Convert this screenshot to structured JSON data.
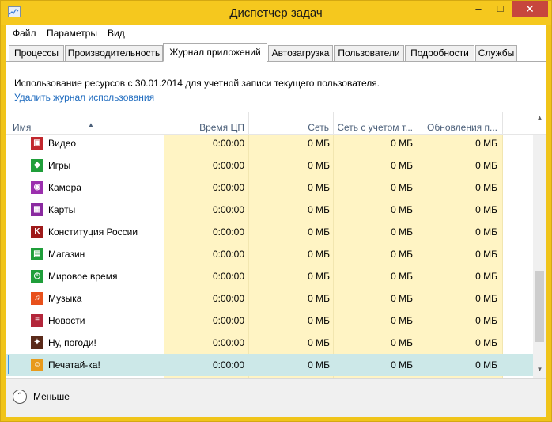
{
  "window": {
    "title": "Диспетчер задач",
    "min_glyph": "–",
    "max_glyph": "□",
    "close_glyph": "✕"
  },
  "menu": [
    {
      "id": "file",
      "label": "Файл"
    },
    {
      "id": "params",
      "label": "Параметры"
    },
    {
      "id": "view",
      "label": "Вид"
    }
  ],
  "tabs": [
    {
      "label": "Процессы"
    },
    {
      "label": "Производительность"
    },
    {
      "label": "Журнал приложений",
      "active": true
    },
    {
      "label": "Автозагрузка"
    },
    {
      "label": "Пользователи"
    },
    {
      "label": "Подробности"
    },
    {
      "label": "Службы"
    }
  ],
  "history": {
    "info_text": "Использование ресурсов с 30.01.2014 для учетной записи текущего пользователя.",
    "delete_link": "Удалить журнал использования"
  },
  "columns": {
    "name": "Имя",
    "cpu": "Время ЦП",
    "net": "Сеть",
    "metered": "Сеть с учетом т...",
    "updates": "Обновления п..."
  },
  "rows": [
    {
      "name": "Видео",
      "icon": "video-icon",
      "color": "#c1272d",
      "glyph": "▣",
      "cpu": "0:00:00",
      "net": "0 МБ",
      "metered": "0 МБ",
      "updates": "0 МБ"
    },
    {
      "name": "Игры",
      "icon": "games-icon",
      "color": "#1f9e3a",
      "glyph": "◆",
      "cpu": "0:00:00",
      "net": "0 МБ",
      "metered": "0 МБ",
      "updates": "0 МБ"
    },
    {
      "name": "Камера",
      "icon": "camera-icon",
      "color": "#9b2fae",
      "glyph": "◉",
      "cpu": "0:00:00",
      "net": "0 МБ",
      "metered": "0 МБ",
      "updates": "0 МБ"
    },
    {
      "name": "Карты",
      "icon": "maps-icon",
      "color": "#8a2aa0",
      "glyph": "▦",
      "cpu": "0:00:00",
      "net": "0 МБ",
      "metered": "0 МБ",
      "updates": "0 МБ"
    },
    {
      "name": "Конституция России",
      "icon": "constitution-icon",
      "color": "#9e1a1a",
      "glyph": "K",
      "cpu": "0:00:00",
      "net": "0 МБ",
      "metered": "0 МБ",
      "updates": "0 МБ"
    },
    {
      "name": "Магазин",
      "icon": "store-icon",
      "color": "#1f9e3a",
      "glyph": "▤",
      "cpu": "0:00:00",
      "net": "0 МБ",
      "metered": "0 МБ",
      "updates": "0 МБ"
    },
    {
      "name": "Мировое время",
      "icon": "clock-icon",
      "color": "#1f9e3a",
      "glyph": "◷",
      "cpu": "0:00:00",
      "net": "0 МБ",
      "metered": "0 МБ",
      "updates": "0 МБ"
    },
    {
      "name": "Музыка",
      "icon": "music-icon",
      "color": "#e8501b",
      "glyph": "♫",
      "cpu": "0:00:00",
      "net": "0 МБ",
      "metered": "0 МБ",
      "updates": "0 МБ"
    },
    {
      "name": "Новости",
      "icon": "news-icon",
      "color": "#b3263a",
      "glyph": "≡",
      "cpu": "0:00:00",
      "net": "0 МБ",
      "metered": "0 МБ",
      "updates": "0 МБ"
    },
    {
      "name": "Ну, погоди!",
      "icon": "game-nu-pogodi-icon",
      "color": "#5a2a1a",
      "glyph": "✦",
      "cpu": "0:00:00",
      "net": "0 МБ",
      "metered": "0 МБ",
      "updates": "0 МБ"
    },
    {
      "name": "Печатай-ка!",
      "icon": "typing-app-icon",
      "color": "#e89a1b",
      "glyph": "☺",
      "cpu": "0:00:00",
      "net": "0 МБ",
      "metered": "0 МБ",
      "updates": "0 МБ",
      "selected": true
    }
  ],
  "footer": {
    "fewer_label": "Меньше",
    "fewer_glyph": "⌃"
  }
}
